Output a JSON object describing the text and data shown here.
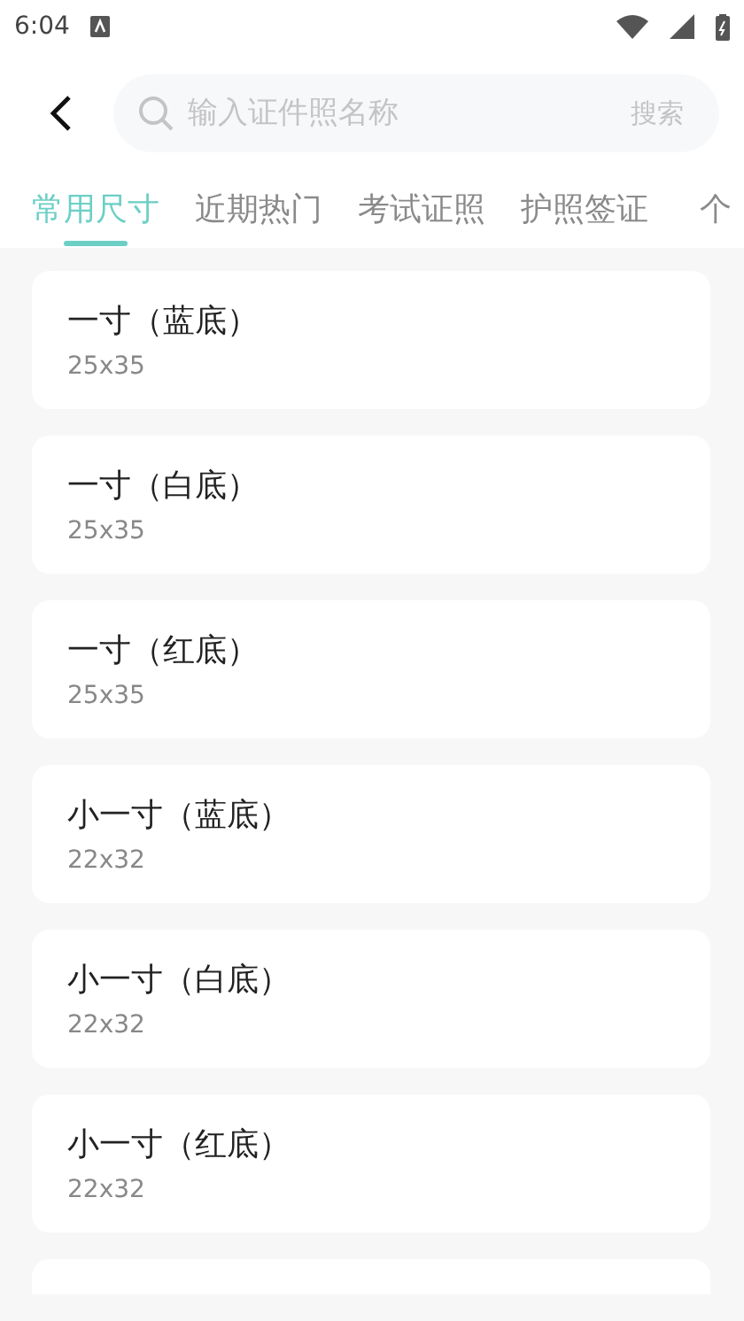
{
  "status_bar": {
    "time": "6:04"
  },
  "search": {
    "placeholder": "输入证件照名称",
    "button": "搜索"
  },
  "tabs": [
    {
      "label": "常用尺寸",
      "selected": true
    },
    {
      "label": "近期热门",
      "selected": false
    },
    {
      "label": "考试证照",
      "selected": false
    },
    {
      "label": "护照签证",
      "selected": false
    },
    {
      "label": "个",
      "selected": false
    }
  ],
  "items": [
    {
      "kind": "size",
      "name": "一寸（蓝底）",
      "size": "25x35"
    },
    {
      "kind": "size",
      "name": "一寸（白底）",
      "size": "25x35"
    },
    {
      "kind": "size",
      "name": "一寸（红底）",
      "size": "25x35"
    },
    {
      "kind": "size",
      "name": "小一寸（蓝底）",
      "size": "22x32"
    },
    {
      "kind": "size",
      "name": "小一寸（白底）",
      "size": "22x32"
    },
    {
      "kind": "size",
      "name": "小一寸（红底）",
      "size": "22x32"
    },
    {
      "kind": "cut"
    }
  ]
}
